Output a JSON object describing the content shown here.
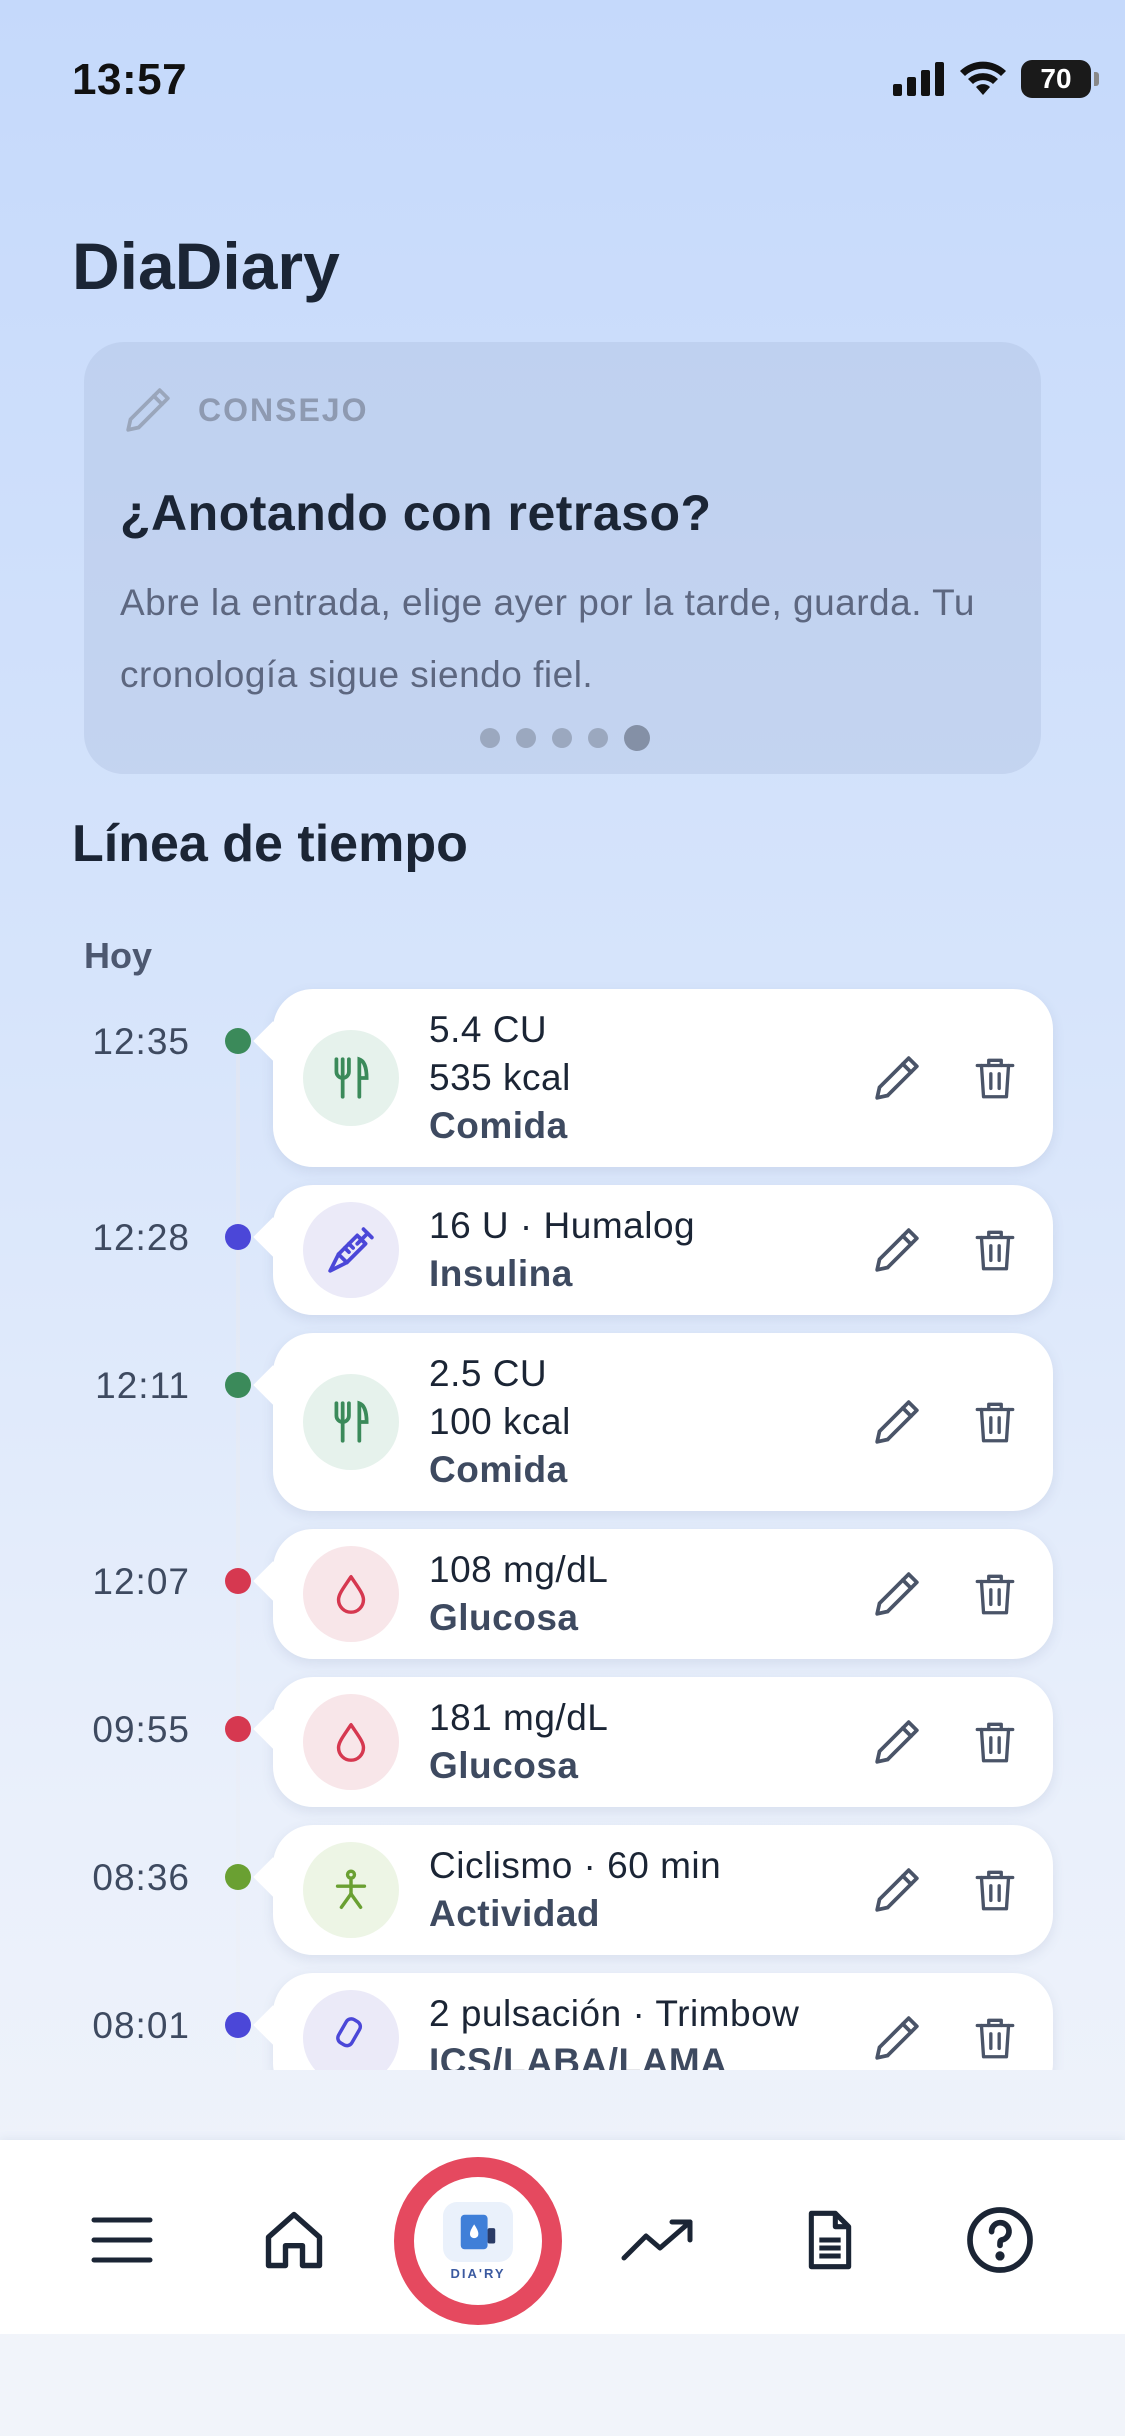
{
  "status": {
    "time": "13:57",
    "battery": "70"
  },
  "app": {
    "title": "DiaDiary"
  },
  "tip": {
    "eyebrow": "CONSEJO",
    "title": "¿Anotando con retraso?",
    "body": "Abre la entrada, elige ayer por la tarde, guarda. Tu cronología sigue siendo fiel.",
    "dot_count": 5,
    "active_dot": 5
  },
  "timeline": {
    "title": "Línea de tiempo",
    "day": "Hoy",
    "entries": [
      {
        "time": "12:35",
        "lines": [
          "5.4 CU",
          "535 kcal"
        ],
        "category": "Comida",
        "icon": "fork-knife-icon",
        "color": "#3b8a5a",
        "bg": "#e6f2ec"
      },
      {
        "time": "12:28",
        "lines": [
          "16 U · Humalog"
        ],
        "category": "Insulina",
        "icon": "syringe-icon",
        "color": "#4b47d8",
        "bg": "#ebeaf8"
      },
      {
        "time": "12:11",
        "lines": [
          "2.5 CU",
          "100 kcal"
        ],
        "category": "Comida",
        "icon": "fork-knife-icon",
        "color": "#3b8a5a",
        "bg": "#e6f2ec"
      },
      {
        "time": "12:07",
        "lines": [
          "108 mg/dL"
        ],
        "category": "Glucosa",
        "icon": "drop-icon",
        "color": "#d63850",
        "bg": "#f8e6e9"
      },
      {
        "time": "09:55",
        "lines": [
          "181 mg/dL"
        ],
        "category": "Glucosa",
        "icon": "drop-icon",
        "color": "#d63850",
        "bg": "#f8e6e9"
      },
      {
        "time": "08:36",
        "lines": [
          "Ciclismo · 60 min"
        ],
        "category": "Actividad",
        "icon": "person-walking-icon",
        "color": "#6aa032",
        "bg": "#edf5e5"
      },
      {
        "time": "08:01",
        "lines": [
          "2 pulsación · Trimbow"
        ],
        "category": "ICS/LABA/LAMA",
        "icon": "inhaler-icon",
        "color": "#4b47d8",
        "bg": "#ebeaf8"
      }
    ]
  },
  "nav": {
    "items": [
      "menu-icon",
      "home-icon",
      "diary-logo",
      "trend-icon",
      "document-icon",
      "help-icon"
    ],
    "center_logo_text": "DIA'RY"
  }
}
